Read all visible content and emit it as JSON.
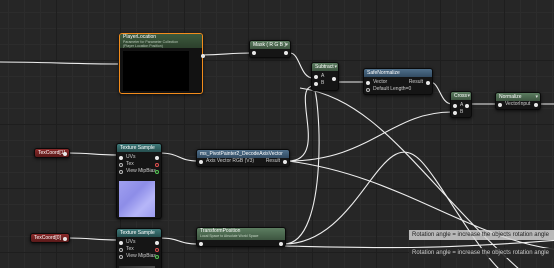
{
  "canvas": {
    "selection_color": "#f28c1c",
    "wire_color": "#ffffff"
  },
  "nodes": {
    "player_location": {
      "title": "PlayerLocation",
      "desc_line1": "Parameter for Parameter Collection",
      "desc_line2": "(Player Location Position)"
    },
    "mask_rgb": {
      "title": "Mask ( R G B )"
    },
    "subtract": {
      "title": "Subtract",
      "pin_a": "A",
      "pin_b": "B"
    },
    "safe_normalize": {
      "title": "SafeNormalize",
      "pin_vector": "Vector",
      "pin_default": "Default Length=0",
      "out_result": "Result"
    },
    "cross": {
      "title": "Cross",
      "pin_a": "A",
      "pin_b": "B"
    },
    "normalize": {
      "title": "Normalize",
      "pin_input": "VectorInput"
    },
    "texcoord_1": {
      "title": "TexCoord[1]"
    },
    "texture_sample_1": {
      "title": "Texture Sample",
      "pins": [
        "UVs",
        "Tex",
        "View MipBias"
      ]
    },
    "decode_axis": {
      "title": "ms_PivotPainter2_DecodeAxisVector",
      "pin_in": "Axis Vector RGB (V3)",
      "out_result": "Result"
    },
    "texcoord_0": {
      "title": "TexCoord[0]"
    },
    "texture_sample_2": {
      "title": "Texture Sample",
      "pins": [
        "UVs",
        "Tex",
        "View MipBias"
      ]
    },
    "transform_position": {
      "title": "TransformPosition",
      "subtitle": "Local Space to Absolute World Space"
    }
  },
  "tooltips": {
    "top": "Rotation angle = increase the objects rotation angle",
    "bottom": "Rotation angle = increase the objects rotation angle"
  }
}
